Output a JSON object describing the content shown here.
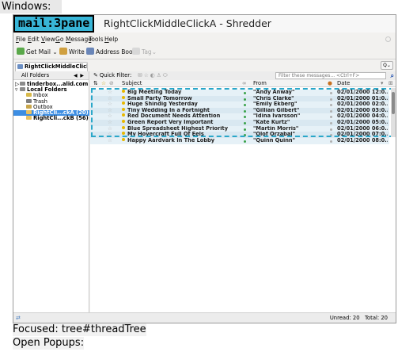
{
  "caption": "Windows:",
  "app_label": "mail:3pane",
  "window_title": "RightClickMiddleClickA - Shredder",
  "menu": [
    "File",
    "Edit",
    "View",
    "Go",
    "Message",
    "Tools",
    "Help"
  ],
  "menu_underline": [
    "F",
    "E",
    "V",
    "G",
    "M",
    "T",
    "H"
  ],
  "toolbar": {
    "get_mail": "Get Mail",
    "write": "Write",
    "address_book": "Address Book",
    "tag": "Tag"
  },
  "tab": {
    "title": "RightClickMiddleClickA",
    "control": "Q"
  },
  "folder_pane": {
    "header": "All Folders",
    "folders": [
      {
        "label": "tinderbox...alid.com",
        "indent": 0,
        "twisty": "▷",
        "color": "#8b8b8b",
        "selected": false
      },
      {
        "label": "Local Folders",
        "indent": 0,
        "twisty": "▿",
        "color": "#8b8b8b",
        "selected": false
      },
      {
        "label": "Inbox",
        "indent": 1,
        "twisty": "",
        "color": "#d8b94a",
        "selected": false
      },
      {
        "label": "Trash",
        "indent": 1,
        "twisty": "",
        "color": "#7e7e7e",
        "selected": false
      },
      {
        "label": "Outbox",
        "indent": 1,
        "twisty": "",
        "color": "#c9a64a",
        "selected": false
      },
      {
        "label": "RightCli...ckA (20)",
        "indent": 1,
        "twisty": "",
        "color": "#e8c060",
        "selected": true
      },
      {
        "label": "RightCli...ckB (56)",
        "indent": 1,
        "twisty": "",
        "color": "#e8c060",
        "selected": false
      }
    ]
  },
  "quick_filter": {
    "label": "Quick Filter:",
    "placeholder": "Filter these messages... <Ctrl+F>"
  },
  "thread_columns": {
    "subject": "Subject",
    "from": "From",
    "date": "Date"
  },
  "messages": [
    {
      "subject": "Big Meeting Today",
      "from": "\"Andy Anway\"",
      "date": "02/01/2000 12:0..."
    },
    {
      "subject": "Small Party Tomorrow",
      "from": "\"Chris Clarke\"",
      "date": "02/01/2000 01:0..."
    },
    {
      "subject": "Huge Shindig Yesterday",
      "from": "\"Emily Ekberg\"",
      "date": "02/01/2000 02:0..."
    },
    {
      "subject": "Tiny Wedding In a Fortnight",
      "from": "\"Gillian Gilbert\"",
      "date": "02/01/2000 03:0..."
    },
    {
      "subject": "Red Document Needs Attention",
      "from": "\"Idina Ivarsson\"",
      "date": "02/01/2000 04:0..."
    },
    {
      "subject": "Green Report Very Important",
      "from": "\"Kate Kurtz\"",
      "date": "02/01/2000 05:0..."
    },
    {
      "subject": "Blue Spreadsheet Highest Priority",
      "from": "\"Martin Morris\"",
      "date": "02/01/2000 06:0..."
    },
    {
      "subject": "My Hovercraft Full Of Eels",
      "from": "\"Olof Orzabal\"",
      "date": "02/01/2000 07:0..."
    },
    {
      "subject": "Happy Aardvark In The Lobby",
      "from": "\"Quinn Quinn\"",
      "date": "02/01/2000 08:0..."
    }
  ],
  "status": {
    "unread": "Unread: 20",
    "total": "Total: 20"
  },
  "focused": "Focused: tree#threadTree",
  "open_popups": "Open Popups:"
}
